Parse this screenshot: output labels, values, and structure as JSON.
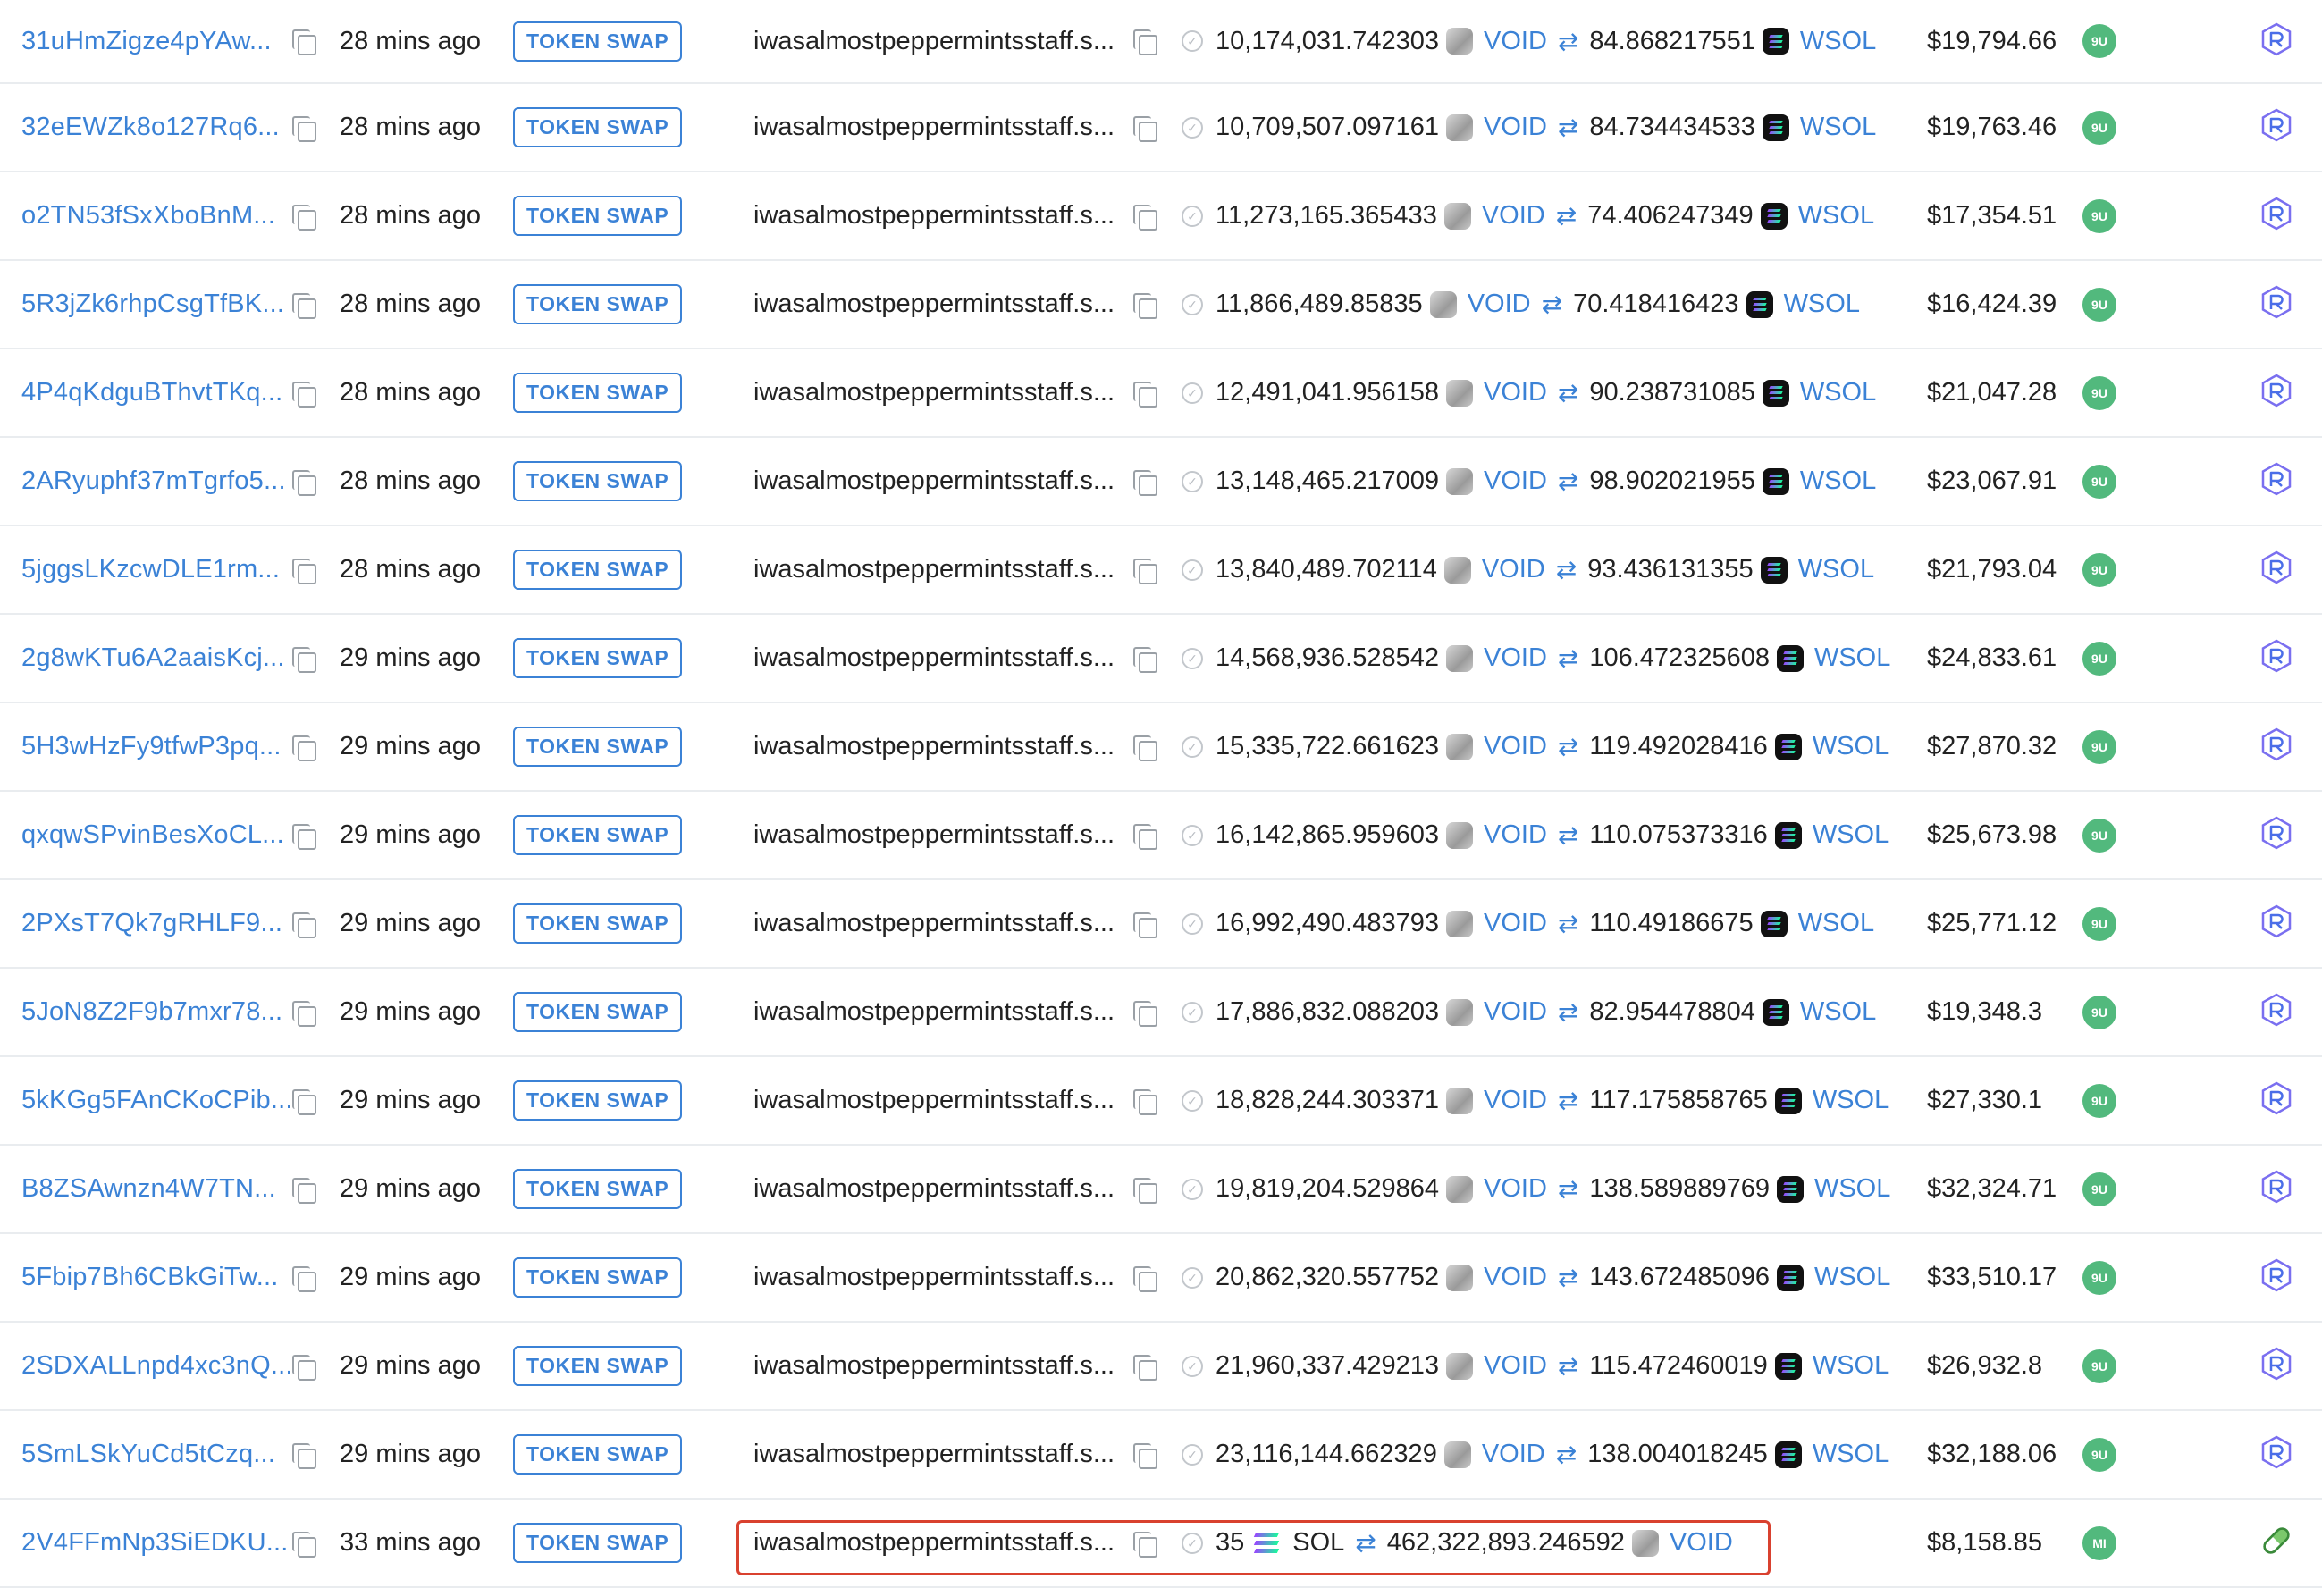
{
  "table": {
    "badge_label": "TOKEN SWAP",
    "highlight_color": "#d9412f",
    "link_color": "#3b82d6",
    "rows": [
      {
        "signature": "31uHmZigze4pYAw...",
        "time": "28 mins ago",
        "signer": "iwasalmostpeppermintsstaff.s...",
        "amount_in": "10,174,031.742303",
        "token_in": "VOID",
        "amount_out": "84.868217551",
        "token_out": "WSOL",
        "usd": "$19,794.66",
        "program": "9U",
        "platform_icon": "raydium-icon"
      },
      {
        "signature": "32eEWZk8o127Rq6...",
        "time": "28 mins ago",
        "signer": "iwasalmostpeppermintsstaff.s...",
        "amount_in": "10,709,507.097161",
        "token_in": "VOID",
        "amount_out": "84.734434533",
        "token_out": "WSOL",
        "usd": "$19,763.46",
        "program": "9U",
        "platform_icon": "raydium-icon"
      },
      {
        "signature": "o2TN53fSxXboBnM...",
        "time": "28 mins ago",
        "signer": "iwasalmostpeppermintsstaff.s...",
        "amount_in": "11,273,165.365433",
        "token_in": "VOID",
        "amount_out": "74.406247349",
        "token_out": "WSOL",
        "usd": "$17,354.51",
        "program": "9U",
        "platform_icon": "raydium-icon"
      },
      {
        "signature": "5R3jZk6rhpCsgTfBK...",
        "time": "28 mins ago",
        "signer": "iwasalmostpeppermintsstaff.s...",
        "amount_in": "11,866,489.85835",
        "token_in": "VOID",
        "amount_out": "70.418416423",
        "token_out": "WSOL",
        "usd": "$16,424.39",
        "program": "9U",
        "platform_icon": "raydium-icon"
      },
      {
        "signature": "4P4qKdguBThvtTKq...",
        "time": "28 mins ago",
        "signer": "iwasalmostpeppermintsstaff.s...",
        "amount_in": "12,491,041.956158",
        "token_in": "VOID",
        "amount_out": "90.238731085",
        "token_out": "WSOL",
        "usd": "$21,047.28",
        "program": "9U",
        "platform_icon": "raydium-icon"
      },
      {
        "signature": "2ARyuphf37mTgrfo5...",
        "time": "28 mins ago",
        "signer": "iwasalmostpeppermintsstaff.s...",
        "amount_in": "13,148,465.217009",
        "token_in": "VOID",
        "amount_out": "98.902021955",
        "token_out": "WSOL",
        "usd": "$23,067.91",
        "program": "9U",
        "platform_icon": "raydium-icon"
      },
      {
        "signature": "5jggsLKzcwDLE1rm...",
        "time": "28 mins ago",
        "signer": "iwasalmostpeppermintsstaff.s...",
        "amount_in": "13,840,489.702114",
        "token_in": "VOID",
        "amount_out": "93.436131355",
        "token_out": "WSOL",
        "usd": "$21,793.04",
        "program": "9U",
        "platform_icon": "raydium-icon"
      },
      {
        "signature": "2g8wKTu6A2aaisKcj...",
        "time": "29 mins ago",
        "signer": "iwasalmostpeppermintsstaff.s...",
        "amount_in": "14,568,936.528542",
        "token_in": "VOID",
        "amount_out": "106.472325608",
        "token_out": "WSOL",
        "usd": "$24,833.61",
        "program": "9U",
        "platform_icon": "raydium-icon"
      },
      {
        "signature": "5H3wHzFy9tfwP3pq...",
        "time": "29 mins ago",
        "signer": "iwasalmostpeppermintsstaff.s...",
        "amount_in": "15,335,722.661623",
        "token_in": "VOID",
        "amount_out": "119.492028416",
        "token_out": "WSOL",
        "usd": "$27,870.32",
        "program": "9U",
        "platform_icon": "raydium-icon"
      },
      {
        "signature": "qxqwSPvinBesXoCL...",
        "time": "29 mins ago",
        "signer": "iwasalmostpeppermintsstaff.s...",
        "amount_in": "16,142,865.959603",
        "token_in": "VOID",
        "amount_out": "110.075373316",
        "token_out": "WSOL",
        "usd": "$25,673.98",
        "program": "9U",
        "platform_icon": "raydium-icon"
      },
      {
        "signature": "2PXsT7Qk7gRHLF9...",
        "time": "29 mins ago",
        "signer": "iwasalmostpeppermintsstaff.s...",
        "amount_in": "16,992,490.483793",
        "token_in": "VOID",
        "amount_out": "110.49186675",
        "token_out": "WSOL",
        "usd": "$25,771.12",
        "program": "9U",
        "platform_icon": "raydium-icon"
      },
      {
        "signature": "5JoN8Z2F9b7mxr78...",
        "time": "29 mins ago",
        "signer": "iwasalmostpeppermintsstaff.s...",
        "amount_in": "17,886,832.088203",
        "token_in": "VOID",
        "amount_out": "82.954478804",
        "token_out": "WSOL",
        "usd": "$19,348.3",
        "program": "9U",
        "platform_icon": "raydium-icon"
      },
      {
        "signature": "5kKGg5FAnCKoCPib...",
        "time": "29 mins ago",
        "signer": "iwasalmostpeppermintsstaff.s...",
        "amount_in": "18,828,244.303371",
        "token_in": "VOID",
        "amount_out": "117.175858765",
        "token_out": "WSOL",
        "usd": "$27,330.1",
        "program": "9U",
        "platform_icon": "raydium-icon"
      },
      {
        "signature": "B8ZSAwnzn4W7TN...",
        "time": "29 mins ago",
        "signer": "iwasalmostpeppermintsstaff.s...",
        "amount_in": "19,819,204.529864",
        "token_in": "VOID",
        "amount_out": "138.589889769",
        "token_out": "WSOL",
        "usd": "$32,324.71",
        "program": "9U",
        "platform_icon": "raydium-icon"
      },
      {
        "signature": "5Fbip7Bh6CBkGiTw...",
        "time": "29 mins ago",
        "signer": "iwasalmostpeppermintsstaff.s...",
        "amount_in": "20,862,320.557752",
        "token_in": "VOID",
        "amount_out": "143.672485096",
        "token_out": "WSOL",
        "usd": "$33,510.17",
        "program": "9U",
        "platform_icon": "raydium-icon"
      },
      {
        "signature": "2SDXALLnpd4xc3nQ...",
        "time": "29 mins ago",
        "signer": "iwasalmostpeppermintsstaff.s...",
        "amount_in": "21,960,337.429213",
        "token_in": "VOID",
        "amount_out": "115.472460019",
        "token_out": "WSOL",
        "usd": "$26,932.8",
        "program": "9U",
        "platform_icon": "raydium-icon"
      },
      {
        "signature": "5SmLSkYuCd5tCzq...",
        "time": "29 mins ago",
        "signer": "iwasalmostpeppermintsstaff.s...",
        "amount_in": "23,116,144.662329",
        "token_in": "VOID",
        "amount_out": "138.004018245",
        "token_out": "WSOL",
        "usd": "$32,188.06",
        "program": "9U",
        "platform_icon": "raydium-icon"
      },
      {
        "signature": "2V4FFmNp3SiEDKU...",
        "time": "33 mins ago",
        "signer": "iwasalmostpeppermintsstaff.s...",
        "amount_in": "35",
        "token_in": "SOL",
        "amount_out": "462,322,893.246592",
        "token_out": "VOID",
        "usd": "$8,158.85",
        "program": "MI",
        "platform_icon": "pill-icon",
        "highlighted": true
      }
    ]
  }
}
